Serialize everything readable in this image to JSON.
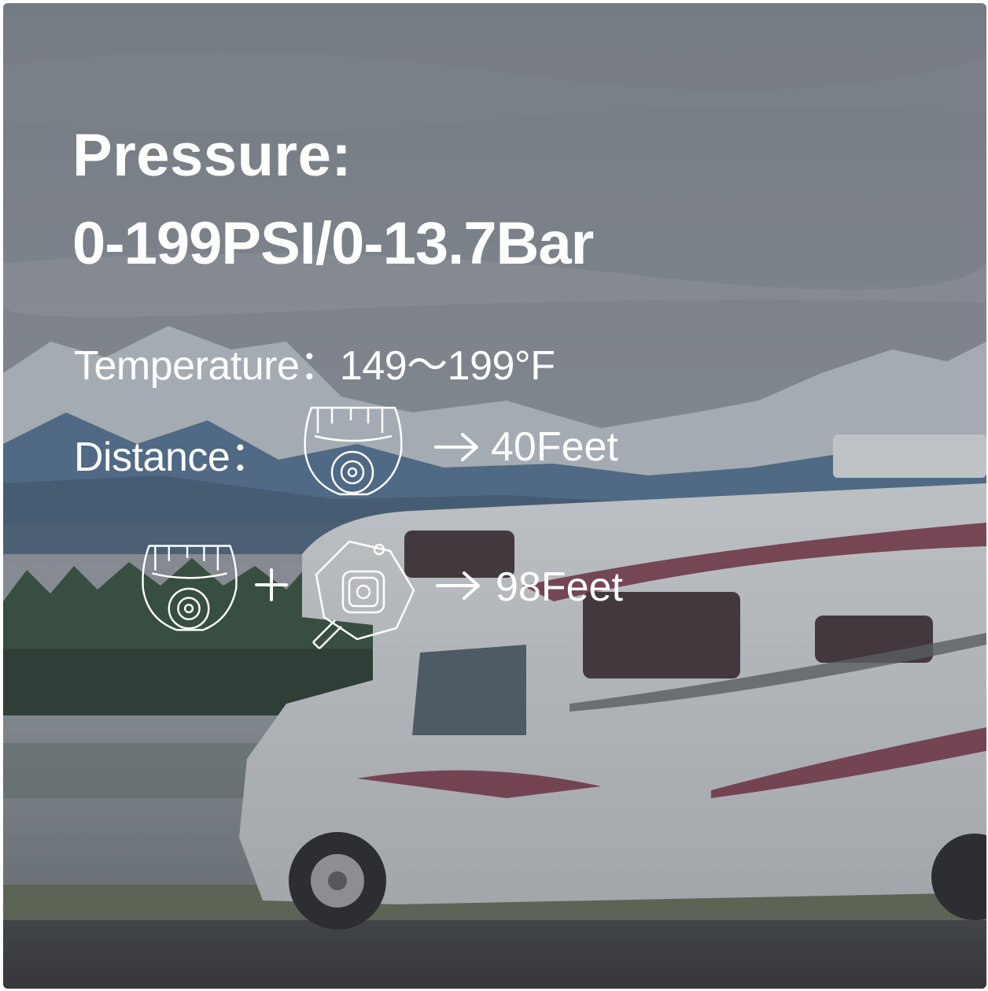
{
  "pressure": {
    "label": "Pressure:",
    "range": "0-199PSI/0-13.7Bar"
  },
  "temperature": {
    "line": "Temperature：149～199°F"
  },
  "distance": {
    "label": "Distance：",
    "single_sensor_range": "40Feet",
    "with_repeater_range": "98Feet"
  },
  "icons": [
    "tire-sensor-icon",
    "arrow-right-icon",
    "plus-icon",
    "signal-repeater-icon"
  ],
  "colors": {
    "text": "#ffffff",
    "overlay": "#5a6068"
  }
}
